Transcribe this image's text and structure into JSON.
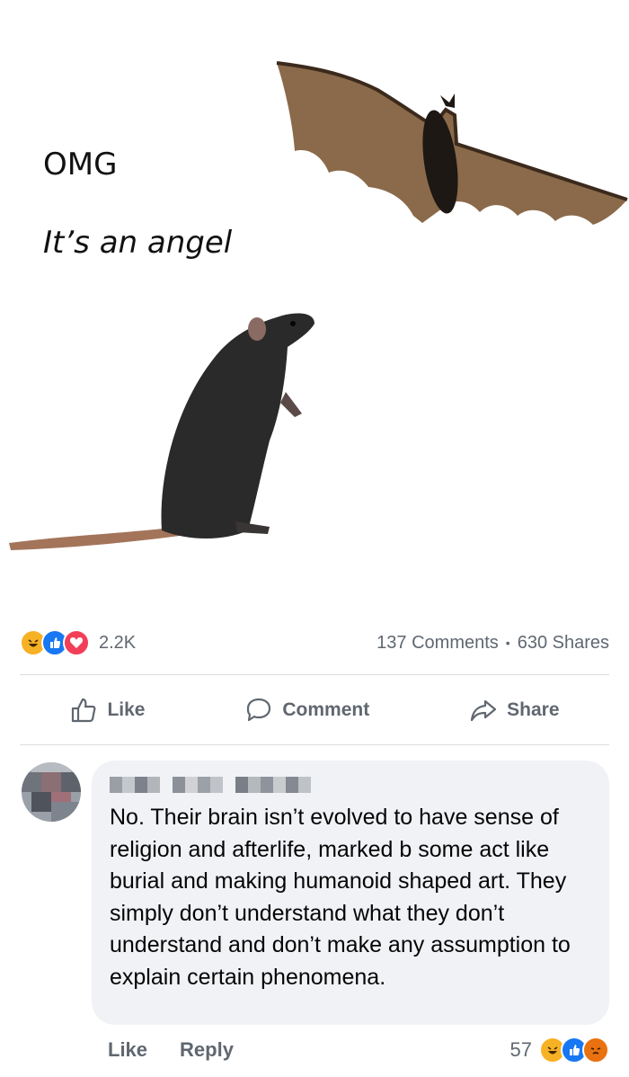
{
  "meme": {
    "line1": "OMG",
    "line2": "It’s an angel"
  },
  "stats": {
    "reactions_count": "2.2K",
    "comments": "137 Comments",
    "separator": "•",
    "shares": "630 Shares"
  },
  "actions": {
    "like": "Like",
    "comment": "Comment",
    "share": "Share"
  },
  "comment": {
    "text": "No. Their brain isn’t evolved to have sense of religion and afterlife, marked b some act like burial and making humanoid shaped art. They simply don’t understand what they don’t understand and don’t make any assumption to explain certain phenomena.",
    "like_label": "Like",
    "reply_label": "Reply",
    "reaction_count": "57"
  },
  "colors": {
    "facebook_blue": "#1877f2",
    "haha": "#f7b125",
    "love": "#f33e58",
    "angry": "#e9710f",
    "muted_text": "#606770",
    "bubble": "#f0f2f5"
  },
  "icons": [
    "haha-icon",
    "like-reaction-icon",
    "love-icon",
    "thumbs-up-icon",
    "comment-icon",
    "share-icon",
    "angry-icon"
  ]
}
